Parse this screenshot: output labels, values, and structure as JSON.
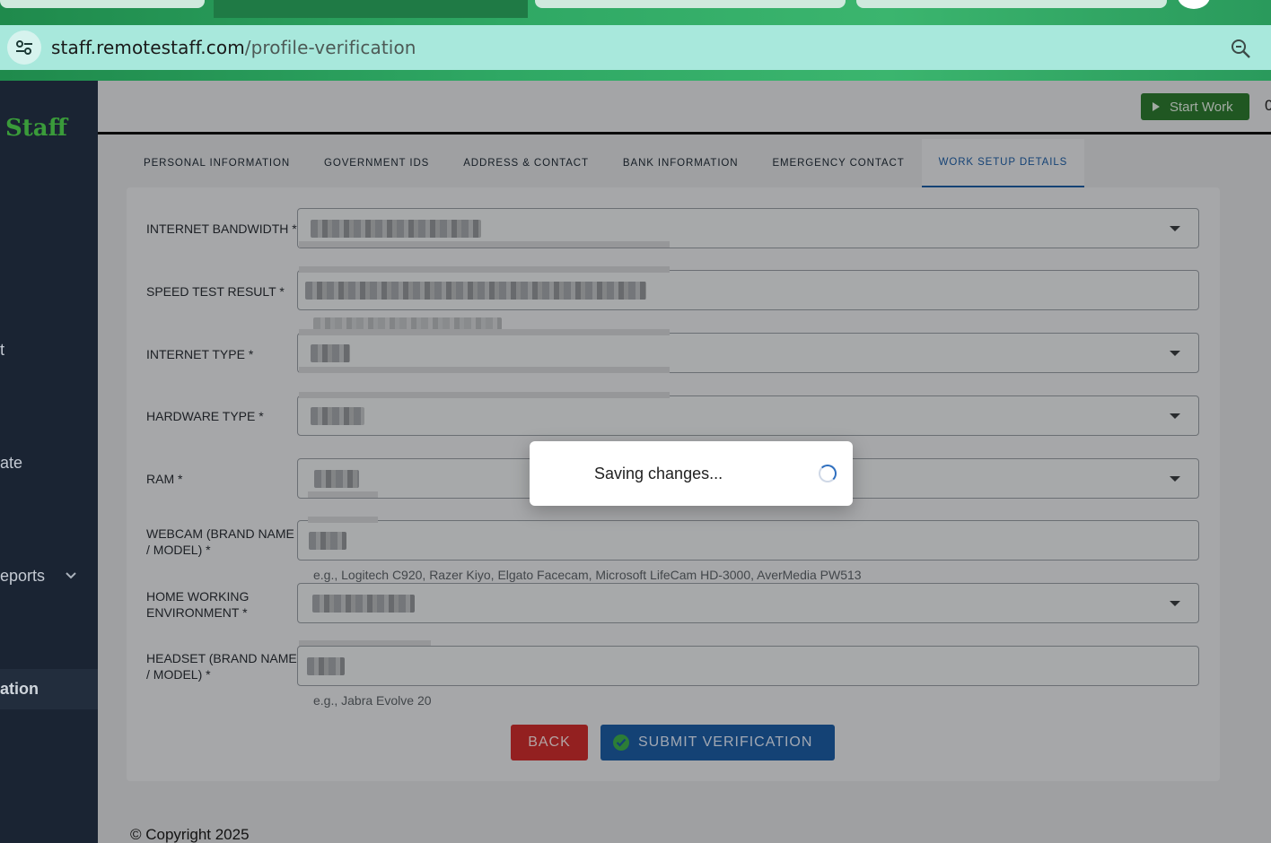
{
  "browser": {
    "url_domain": "staff.remotestaff.com",
    "url_path": "/profile-verification"
  },
  "sidebar": {
    "brand": "Staff",
    "items": [
      {
        "label": "t"
      },
      {
        "label": "ate"
      },
      {
        "label": "eports"
      },
      {
        "label": "ation"
      }
    ]
  },
  "header": {
    "start_work_label": "Start Work",
    "cut_text": "0"
  },
  "tabs": [
    {
      "label": "PERSONAL INFORMATION"
    },
    {
      "label": "GOVERNMENT IDS"
    },
    {
      "label": "ADDRESS & CONTACT"
    },
    {
      "label": "BANK INFORMATION"
    },
    {
      "label": "EMERGENCY CONTACT"
    },
    {
      "label": "WORK SETUP DETAILS"
    }
  ],
  "active_tab": "WORK SETUP DETAILS",
  "form": {
    "internet_bandwidth_label": "INTERNET BANDWIDTH *",
    "speed_test_label": "SPEED TEST RESULT *",
    "internet_type_label": "INTERNET TYPE *",
    "hardware_type_label": "HARDWARE TYPE *",
    "ram_label": "RAM *",
    "webcam_label_1": "WEBCAM (BRAND NAME",
    "webcam_label_2": "/ MODEL) *",
    "webcam_helper": "e.g., Logitech C920, Razer Kiyo, Elgato Facecam, Microsoft LifeCam HD-3000, AverMedia PW513",
    "home_env_label_1": "HOME WORKING",
    "home_env_label_2": "ENVIRONMENT *",
    "headset_label_1": "HEADSET (BRAND NAME",
    "headset_label_2": "/ MODEL) *",
    "headset_helper": "e.g., Jabra Evolve 20"
  },
  "buttons": {
    "back": "BACK",
    "submit": "SUBMIT VERIFICATION"
  },
  "footer": {
    "copyright": "© Copyright 2025"
  },
  "modal": {
    "text": "Saving changes..."
  }
}
